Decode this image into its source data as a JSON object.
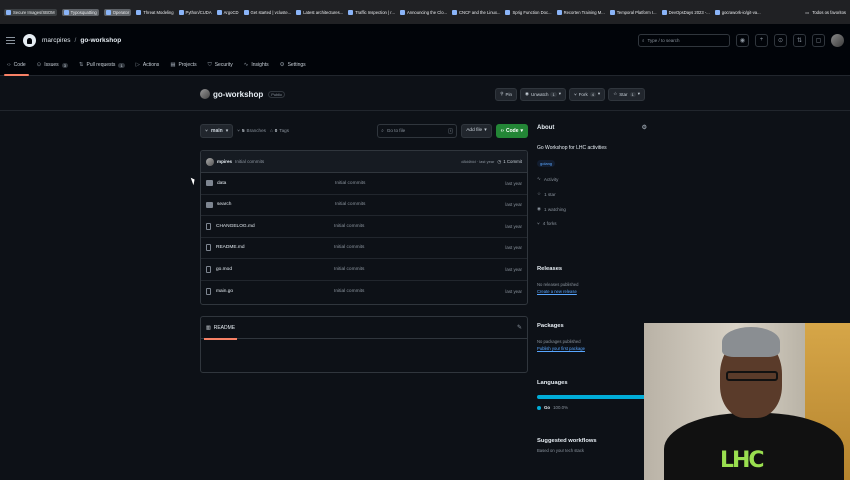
{
  "bookmarks": [
    {
      "label": "Secure Images/SBOM",
      "style": "tag"
    },
    {
      "label": "Typosquatting",
      "style": "hl"
    },
    {
      "label": "Operator",
      "style": "hl"
    },
    {
      "label": "Threat Modeling",
      "style": "plain"
    },
    {
      "label": "Python/CUDA",
      "style": "plain"
    },
    {
      "label": "ArgoCD",
      "style": "plain"
    },
    {
      "label": "Get started | vcluste...",
      "style": "plain"
    },
    {
      "label": "Latest architectures...",
      "style": "plain"
    },
    {
      "label": "Traffic Inspection | r...",
      "style": "plain"
    },
    {
      "label": "Announcing the Clo...",
      "style": "plain"
    },
    {
      "label": "CNCF and the Linux...",
      "style": "plain"
    },
    {
      "label": "Sprig Function Doc...",
      "style": "plain"
    },
    {
      "label": "Recorten Training M...",
      "style": "plain"
    },
    {
      "label": "Temporal Platform I...",
      "style": "plain"
    },
    {
      "label": "DevOpsDays 2023 -...",
      "style": "plain"
    },
    {
      "label": "gocrawork-io/git-va...",
      "style": "plain"
    }
  ],
  "bookmarks_right": "Todos os favoritos",
  "header": {
    "owner": "marcpires",
    "separator": "/",
    "repo": "go-workshop",
    "search_placeholder": "Type / to search"
  },
  "repo_nav": [
    {
      "label": "Code",
      "icon": "code-icon",
      "count": "",
      "active": true
    },
    {
      "label": "Issues",
      "icon": "issue-icon",
      "count": "3",
      "active": false
    },
    {
      "label": "Pull requests",
      "icon": "pull-request-icon",
      "count": "1",
      "active": false
    },
    {
      "label": "Actions",
      "icon": "play-icon",
      "count": "",
      "active": false
    },
    {
      "label": "Projects",
      "icon": "table-icon",
      "count": "",
      "active": false
    },
    {
      "label": "Security",
      "icon": "shield-icon",
      "count": "",
      "active": false
    },
    {
      "label": "Insights",
      "icon": "graph-icon",
      "count": "",
      "active": false
    },
    {
      "label": "Settings",
      "icon": "gear-icon",
      "count": "",
      "active": false
    }
  ],
  "repo": {
    "name": "go-workshop",
    "visibility": "Public",
    "pin_label": "Pin",
    "unwatch_label": "Unwatch",
    "unwatch_count": "1",
    "fork_label": "Fork",
    "fork_count": "4",
    "star_label": "Star",
    "star_count": "1"
  },
  "branch_bar": {
    "branch": "main",
    "branches_count": "5",
    "branches_label": "Branches",
    "tags_count": "0",
    "tags_label": "Tags",
    "goto_placeholder": "Go to file",
    "goto_kbd": "t",
    "add_file_label": "Add file",
    "code_label": "Code"
  },
  "latest_commit": {
    "author": "mpires",
    "message": "Initial commits",
    "hash_time": "d8d4fdd · last year",
    "commits_label": "1 Commit"
  },
  "files": [
    {
      "name": "data",
      "type": "dir",
      "message": "Initial commits",
      "date": "last year"
    },
    {
      "name": "search",
      "type": "dir",
      "message": "Initial commits",
      "date": "last year"
    },
    {
      "name": "CHANGELOG.md",
      "type": "file",
      "message": "Initial commits",
      "date": "last year"
    },
    {
      "name": "README.md",
      "type": "file",
      "message": "Initial commits",
      "date": "last year"
    },
    {
      "name": "go.mod",
      "type": "file",
      "message": "Initial commits",
      "date": "last year"
    },
    {
      "name": "main.go",
      "type": "file",
      "message": "Initial commits",
      "date": "last year"
    }
  ],
  "readme": {
    "tab_label": "README"
  },
  "about": {
    "title": "About",
    "description": "Go Workshop for LHC activities",
    "topic": "golang",
    "stats": [
      {
        "icon": "pulse-icon",
        "label": "Activity"
      },
      {
        "icon": "star-icon",
        "label": "1 star"
      },
      {
        "icon": "eye-icon",
        "label": "1 watching"
      },
      {
        "icon": "fork-icon",
        "label": "4 forks"
      }
    ]
  },
  "releases": {
    "title": "Releases",
    "muted": "No releases published",
    "link": "Create a new release"
  },
  "packages": {
    "title": "Packages",
    "muted": "No packages published",
    "link": "Publish your first package"
  },
  "languages": {
    "title": "Languages",
    "items": [
      {
        "name": "Go",
        "percent": "100.0%",
        "color": "#00add8",
        "share": 1.0
      }
    ]
  },
  "workflows": {
    "title": "Suggested workflows",
    "muted": "Based on your tech stack"
  },
  "colors": {
    "accent_tab": "#f78166",
    "code_button": "#238636",
    "link": "#58a6ff",
    "background": "#0d1117"
  }
}
